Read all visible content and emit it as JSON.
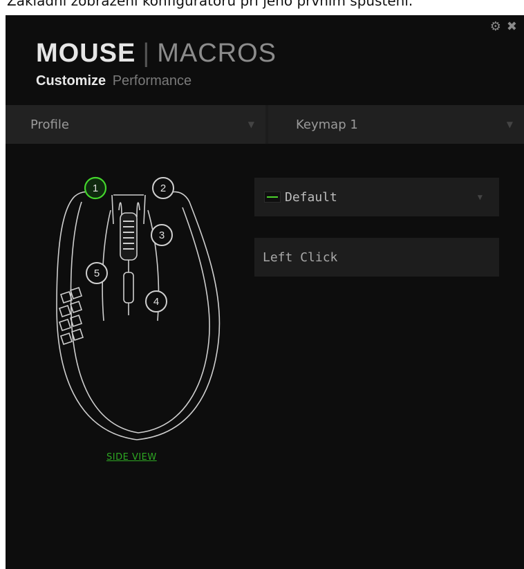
{
  "caption": "Základní zobrazení konfigurátoru při jeho prvním spuštění.",
  "window": {
    "settings_icon": "gear-icon",
    "close_icon": "close-icon"
  },
  "tabs": {
    "main": [
      {
        "label": "MOUSE",
        "active": true
      },
      {
        "label": "MACROS",
        "active": false
      }
    ],
    "sub": [
      {
        "label": "Customize",
        "active": true
      },
      {
        "label": "Performance",
        "active": false
      }
    ]
  },
  "toolbar": {
    "profile_label": "Profile",
    "keymap_label": "Keymap 1"
  },
  "mouse": {
    "buttons": [
      {
        "num": "1",
        "selected": true
      },
      {
        "num": "2",
        "selected": false
      },
      {
        "num": "3",
        "selected": false
      },
      {
        "num": "4",
        "selected": false
      },
      {
        "num": "5",
        "selected": false
      }
    ],
    "side_view_label": "SIDE VIEW"
  },
  "assignment": {
    "selected": "Default",
    "function": "Left Click"
  },
  "colors": {
    "accent": "#44d62c",
    "background": "#0d0d0d",
    "panel": "#1d1d1d"
  }
}
